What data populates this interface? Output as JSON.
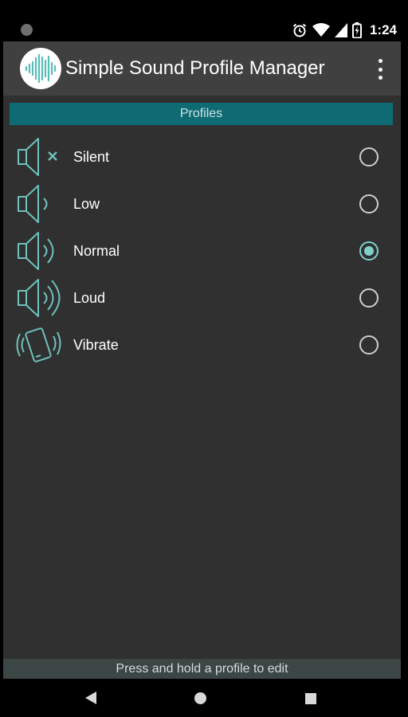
{
  "status_bar": {
    "time": "1:24",
    "icons": [
      "notification-dot-icon",
      "alarm-icon",
      "wifi-icon",
      "signal-icon",
      "battery-icon"
    ]
  },
  "app_bar": {
    "title": "Simple Sound Profile Manager",
    "logo_icon": "sound-wave-logo-icon",
    "menu_icon": "overflow-menu-icon"
  },
  "section": {
    "title": "Profiles"
  },
  "profiles": [
    {
      "label": "Silent",
      "icon": "speaker-muted-icon",
      "selected": false
    },
    {
      "label": "Low",
      "icon": "speaker-low-icon",
      "selected": false
    },
    {
      "label": "Normal",
      "icon": "speaker-normal-icon",
      "selected": true
    },
    {
      "label": "Loud",
      "icon": "speaker-loud-icon",
      "selected": false
    },
    {
      "label": "Vibrate",
      "icon": "phone-vibrate-icon",
      "selected": false
    }
  ],
  "footer": {
    "hint": "Press and hold a profile to edit"
  },
  "nav": {
    "icons": [
      "back-icon",
      "home-icon",
      "recents-icon"
    ]
  },
  "colors": {
    "accent": "#7fd0cb",
    "header": "#0e6b73",
    "background": "#303030",
    "app_bar": "#404040"
  }
}
